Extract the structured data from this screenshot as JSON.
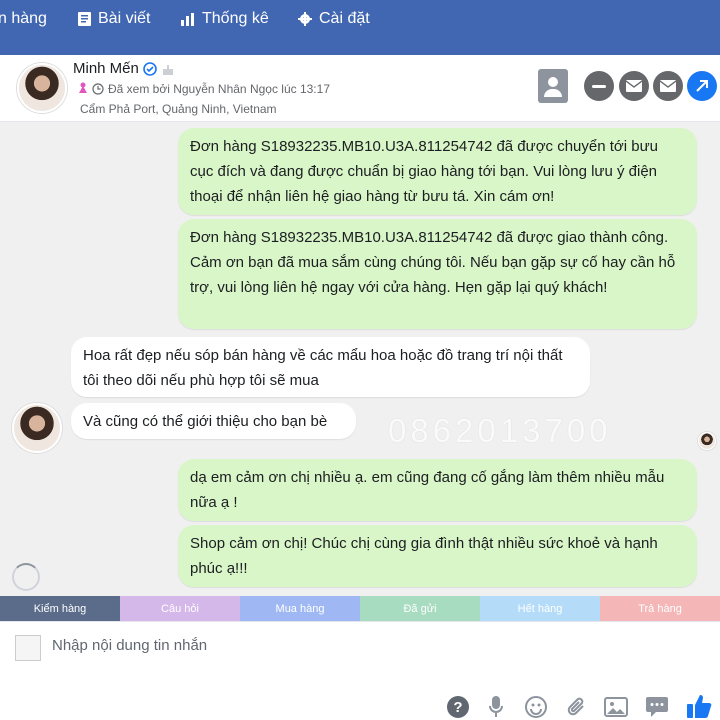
{
  "nav": {
    "items": [
      {
        "label": "n hàng"
      },
      {
        "label": "Bài viết"
      },
      {
        "label": "Thống kê"
      },
      {
        "label": "Cài đặt"
      }
    ]
  },
  "header": {
    "name": "Minh Mến",
    "seen_by": "Đã xem bởi Nguyễn Nhân Ngọc lúc 13:17",
    "location": "Cẩm Phả Port, Quảng Ninh, Vietnam"
  },
  "messages": [
    {
      "dir": "out",
      "text": "Đơn hàng S18932235.MB10.U3A.811254742 đã được chuyển tới bưu cục đích và đang được chuẩn bị giao hàng tới bạn. Vui lòng lưu ý điện thoại để nhận liên hệ giao hàng từ bưu tá. Xin cám ơn!"
    },
    {
      "dir": "out",
      "text": "Đơn hàng S18932235.MB10.U3A.811254742 đã được giao thành công. Cảm ơn bạn đã mua sắm cùng chúng tôi. Nếu bạn gặp sự cố hay cần hỗ trợ, vui lòng liên hệ ngay với cửa hàng. Hẹn gặp lại quý khách!"
    },
    {
      "dir": "in",
      "text": "Hoa rất đẹp nếu sóp bán hàng về các mẩu hoa hoặc đồ trang trí nội thất tôi theo dõi nếu phù hợp tôi sẽ mua"
    },
    {
      "dir": "in",
      "text": "Và cũng có thể giới thiệu cho bạn bè"
    },
    {
      "dir": "out",
      "text": "dạ em cảm ơn chị nhiều ạ. em cũng đang cố gắng làm thêm nhiều mẫu nữa ạ !"
    },
    {
      "dir": "out",
      "text": "Shop cảm ơn chị! Chúc chị cùng gia đình thật nhiều sức khoẻ và hạnh phúc ạ!!!"
    }
  ],
  "watermark": "0862013700",
  "tags": [
    {
      "label": "Kiểm hàng",
      "color": "#5b6b8a"
    },
    {
      "label": "Câu hỏi",
      "color": "#d5b8ea"
    },
    {
      "label": "Mua hàng",
      "color": "#9fb8f4"
    },
    {
      "label": "Đã gửi",
      "color": "#a8dcc0"
    },
    {
      "label": "Hết hàng",
      "color": "#b4dcf8"
    },
    {
      "label": "Trả hàng",
      "color": "#f4b6b6"
    }
  ],
  "composer": {
    "placeholder": "Nhập nội dung tin nhắn"
  },
  "colors": {
    "nav": "#4267b2",
    "outgoing": "#d9f6c8",
    "accent": "#1877f2",
    "like": "#1877f2"
  },
  "icons": [
    "article-icon",
    "chart-icon",
    "gear-icon",
    "contact-card-icon",
    "minus-icon",
    "mail-icon",
    "mail-icon",
    "share-icon",
    "help-icon",
    "microphone-icon",
    "emoji-icon",
    "attachment-icon",
    "image-icon",
    "quick-reply-icon",
    "like-icon"
  ]
}
